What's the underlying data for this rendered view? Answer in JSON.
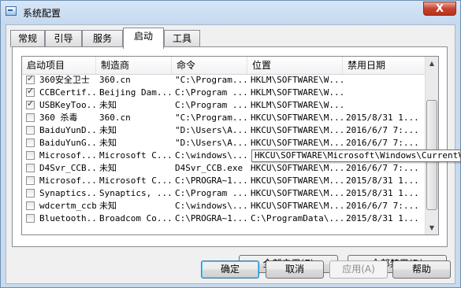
{
  "window": {
    "title": "系统配置",
    "close_label": "X"
  },
  "tabs": [
    {
      "label": "常规",
      "active": false
    },
    {
      "label": "引导",
      "active": false
    },
    {
      "label": "服务",
      "active": false
    },
    {
      "label": "启动",
      "active": true
    },
    {
      "label": "工具",
      "active": false
    }
  ],
  "startup": {
    "columns": [
      "启动项目",
      "制造商",
      "命令",
      "位置",
      "禁用日期"
    ],
    "rows": [
      {
        "checked": true,
        "item": "360安全卫士",
        "maker": "360.cn",
        "command": "\"C:\\Program...",
        "location": "HKLM\\SOFTWARE\\W...",
        "date": ""
      },
      {
        "checked": true,
        "item": "CCBCertif...",
        "maker": "Beijing Dam...",
        "command": "C:\\Program ...",
        "location": "HKLM\\SOFTWARE\\W...",
        "date": ""
      },
      {
        "checked": true,
        "item": "USBKeyToo...",
        "maker": "未知",
        "command": "C:\\Program ...",
        "location": "HKLM\\SOFTWARE\\W...",
        "date": ""
      },
      {
        "checked": false,
        "item": "360 杀毒",
        "maker": "360.cn",
        "command": "\"C:\\Program...",
        "location": "HKCU\\SOFTWARE\\M...",
        "date": "2015/8/31 1..."
      },
      {
        "checked": false,
        "item": "BaiduYunD...",
        "maker": "未知",
        "command": "\"D:\\Users\\A...",
        "location": "HKCU\\SOFTWARE\\M...",
        "date": "2016/6/7 7:..."
      },
      {
        "checked": false,
        "item": "BaiduYunG...",
        "maker": "未知",
        "command": "\"D:\\Users\\A...",
        "location": "HKCU\\SOFTWARE\\M...",
        "date": "2016/6/7 7:..."
      },
      {
        "checked": false,
        "item": "Microsof...",
        "maker": "Microsoft C...",
        "command": "C:\\windows\\...",
        "location": "",
        "date": ""
      },
      {
        "checked": false,
        "item": "D4Svr_CCB...",
        "maker": "未知",
        "command": "D4Svr_CCB.exe",
        "location": "HKCU\\SOFTWARE\\M...",
        "date": "2016/6/7 7:..."
      },
      {
        "checked": false,
        "item": "Microsof...",
        "maker": "Microsoft C...",
        "command": "C:\\PROGRA~1...",
        "location": "HKCU\\SOFTWARE\\M...",
        "date": "2015/8/31 1..."
      },
      {
        "checked": false,
        "item": "Synaptics...",
        "maker": "Synaptics, ...",
        "command": "C:\\Program ...",
        "location": "HKCU\\SOFTWARE\\M...",
        "date": "2015/8/31 1..."
      },
      {
        "checked": false,
        "item": "wdcertm_ccb",
        "maker": "未知",
        "command": "C:\\windows\\...",
        "location": "HKCU\\SOFTWARE\\M...",
        "date": "2016/6/7 7:..."
      },
      {
        "checked": false,
        "item": "Bluetooth...",
        "maker": "Broadcom Co...",
        "command": "C:\\PROGRA~1...",
        "location": "C:\\ProgramData\\...",
        "date": "2015/8/31 1..."
      }
    ],
    "tooltip": "HKCU\\SOFTWARE\\Microsoft\\Windows\\CurrentVersion\\Run"
  },
  "buttons": {
    "enable_all": "全部启用(E)",
    "disable_all": "全部禁用(D)",
    "ok": "确定",
    "cancel": "取消",
    "apply": "应用(A)",
    "help": "帮助"
  }
}
